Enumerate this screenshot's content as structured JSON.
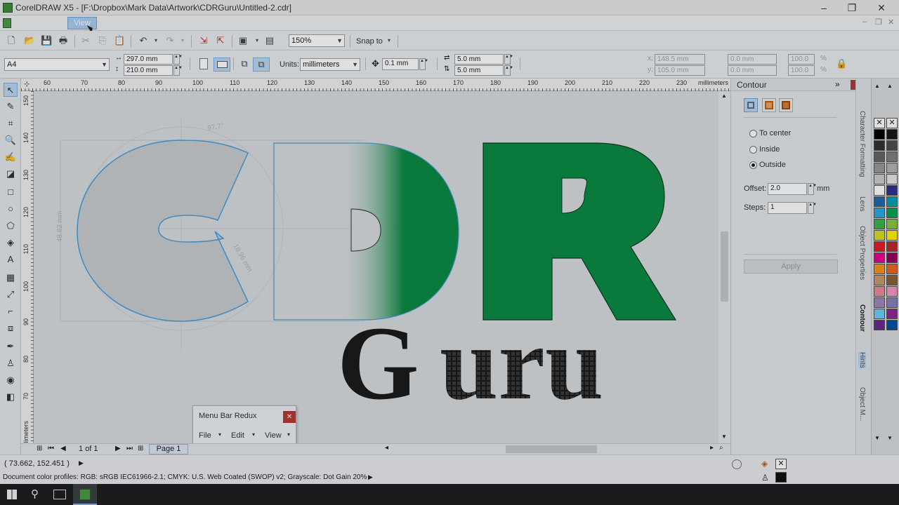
{
  "window": {
    "title": "CorelDRAW X5 - [F:\\Dropbox\\Mark Data\\Artwork\\CDRGuru\\Untitled-2.cdr]",
    "minimize": "–",
    "restore": "❐",
    "close": "✕"
  },
  "menubar": {
    "view_label": "View",
    "mdi_min": "–",
    "mdi_restore": "❐",
    "mdi_close": "✕"
  },
  "stdbar": {
    "zoom": "150%",
    "snap_to": "Snap to"
  },
  "propbar": {
    "paper": "A4",
    "width": "297.0 mm",
    "height": "210.0 mm",
    "units_label": "Units:",
    "units_value": "millimeters",
    "nudge": "0.1 mm",
    "dup_x": "5.0 mm",
    "dup_y": "5.0 mm",
    "pos_x_label": "x:",
    "pos_x": "148.5 mm",
    "pos_y_label": "y:",
    "pos_y": "105.0 mm",
    "size_w": "0.0 mm",
    "size_h": "0.0 mm",
    "scale_w": "100.0",
    "scale_h": "100.0",
    "scale_unit": "%"
  },
  "ruler": {
    "h_ticks": [
      "60",
      "70",
      "80",
      "90",
      "100",
      "110",
      "120",
      "130",
      "140",
      "150",
      "160",
      "170",
      "180",
      "190",
      "200",
      "210",
      "220",
      "230"
    ],
    "h_unit": "millimeters",
    "v_ticks": [
      "150",
      "140",
      "130",
      "120",
      "110",
      "100",
      "90",
      "80",
      "70"
    ],
    "v_unit": "millimeters"
  },
  "artwork": {
    "letters_top": [
      "C",
      "D",
      "R"
    ],
    "word_bottom": "Guru",
    "colors": {
      "green": "#0c8a45",
      "outline_blue": "#4a9ed8",
      "grey_fill": "#c9ccd0",
      "dark": "#1b1b1b"
    },
    "dim_angle": "97.7°",
    "dim_len": "18.96 mm",
    "dim_h": "48.82 mm"
  },
  "pager": {
    "page_of": "1 of 1",
    "page_tab": "Page 1"
  },
  "docker": {
    "title": "Contour",
    "options": [
      {
        "label": "To center",
        "selected": false
      },
      {
        "label": "Inside",
        "selected": false
      },
      {
        "label": "Outside",
        "selected": true
      }
    ],
    "offset_label": "Offset:",
    "offset_value": "2.0",
    "offset_unit": "mm",
    "steps_label": "Steps:",
    "steps_value": "1",
    "apply": "Apply"
  },
  "docker_tabs": [
    "Character Formatting",
    "Lens",
    "Object Properties",
    "Contour",
    "Hints",
    "Object M..."
  ],
  "palette": [
    "#000000",
    "#1a1a1a",
    "#333333",
    "#4d4d4d",
    "#666666",
    "#808080",
    "#999999",
    "#b3b3b3",
    "#cccccc",
    "#e6e6e6",
    "#ffffff",
    "#2e3192",
    "#1f68b2",
    "#00a3b3",
    "#29abe2",
    "#00a651",
    "#39b54a",
    "#8dc63f",
    "#d7df23",
    "#fff200",
    "#ed1c24",
    "#c1272d",
    "#ec008c",
    "#9e005d",
    "#f7941d",
    "#f26522",
    "#c69c6d",
    "#8c6239",
    "#ee8aa0",
    "#f49ac1",
    "#a186be",
    "#8781bd",
    "#6dcff6",
    "#92278f",
    "#662d91",
    "#0054a6"
  ],
  "floatbar": {
    "title": "Menu Bar Redux",
    "close": "✕",
    "menus": [
      "File",
      "Edit",
      "View"
    ]
  },
  "status": {
    "coords": "( 73.662, 152.451 )",
    "color_profiles": "Document color profiles: RGB: sRGB IEC61966-2.1; CMYK: U.S. Web Coated (SWOP) v2; Grayscale: Dot Gain 20%"
  }
}
